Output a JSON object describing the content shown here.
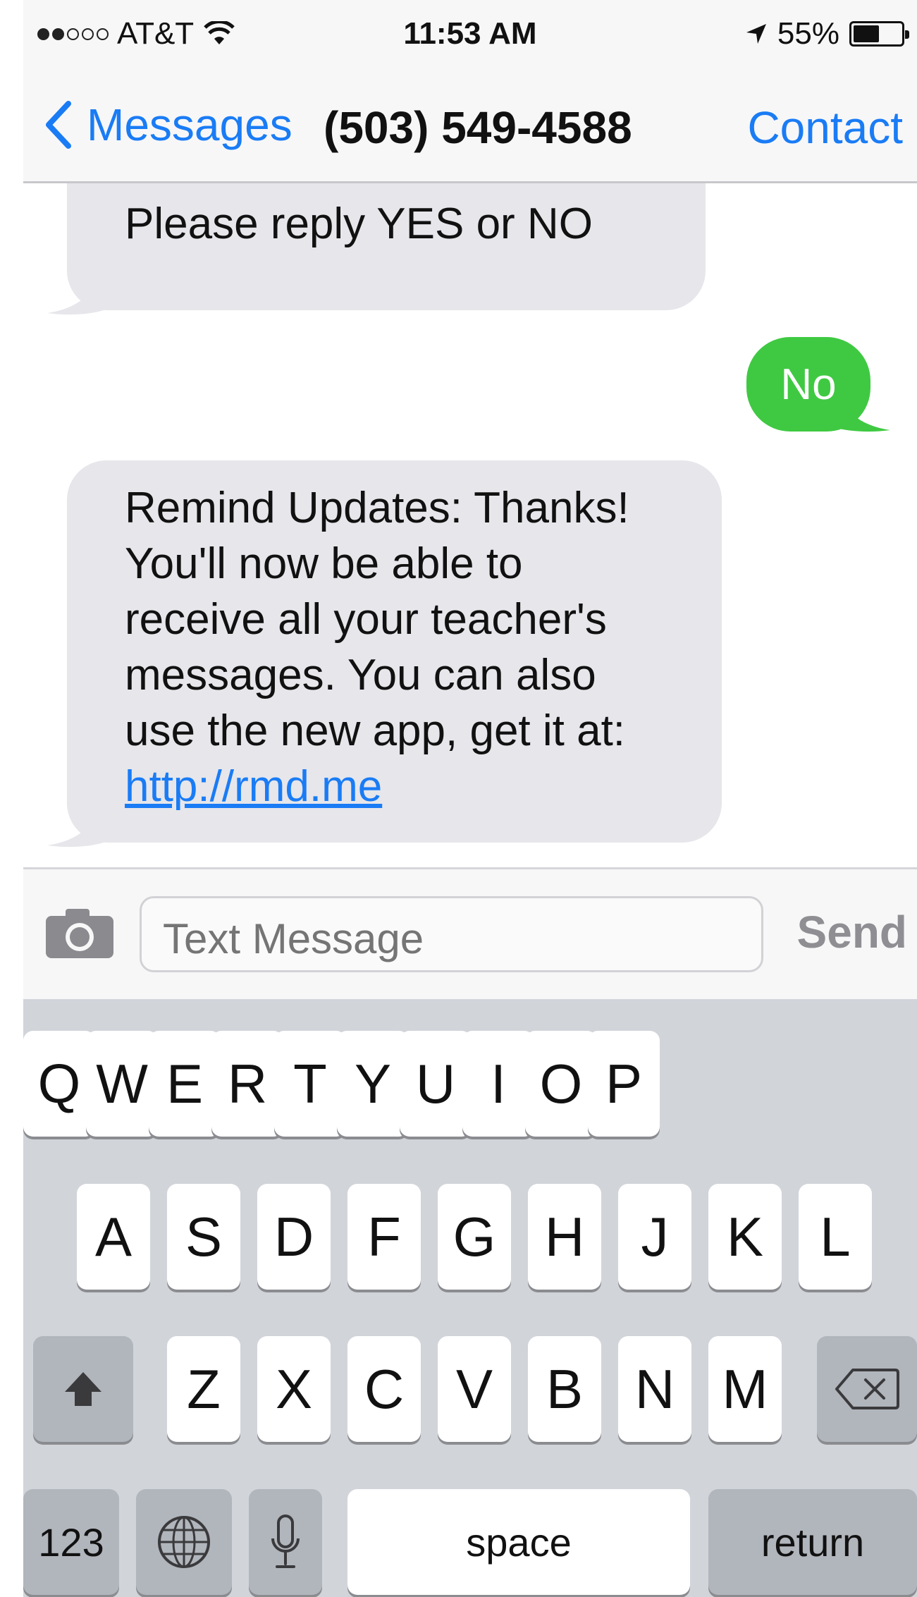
{
  "status_bar": {
    "carrier": "AT&T",
    "time": "11:53 AM",
    "battery": "55%",
    "battery_level": 0.55,
    "signal_bars": 2,
    "icons": [
      "signal-dots-icon",
      "wifi-icon",
      "location-arrow-icon",
      "battery-icon"
    ]
  },
  "nav": {
    "back_label": "Messages",
    "title": "(503) 549-4588",
    "contact_label": "Contact",
    "icons": [
      "chevron-left-icon"
    ]
  },
  "conversation": {
    "messages": [
      {
        "direction": "incoming",
        "lines": [
          "Please reply YES or NO"
        ]
      },
      {
        "direction": "outgoing",
        "lines": [
          "No"
        ]
      },
      {
        "direction": "incoming",
        "lines": [
          "Remind Updates: Thanks!",
          "You'll now be able to",
          "receive all your teacher's",
          "messages. You can also",
          "use the new app, get it at:"
        ],
        "link": "http://rmd.me"
      }
    ]
  },
  "input_bar": {
    "placeholder": "Text Message",
    "send_label": "Send",
    "icons": [
      "camera-icon"
    ]
  },
  "keyboard": {
    "row1": [
      "Q",
      "W",
      "E",
      "R",
      "T",
      "Y",
      "U",
      "I",
      "O",
      "P"
    ],
    "row2": [
      "A",
      "S",
      "D",
      "F",
      "G",
      "H",
      "J",
      "K",
      "L"
    ],
    "row3": [
      "Z",
      "X",
      "C",
      "V",
      "B",
      "N",
      "M"
    ],
    "numbers_label": "123",
    "space_label": "space",
    "return_label": "return",
    "icons": [
      "shift-icon",
      "delete-icon",
      "globe-icon",
      "microphone-icon"
    ]
  },
  "colors": {
    "accent_blue": "#1a7cf5",
    "outgoing_bubble": "#3fc942",
    "incoming_bubble": "#e6e6eb",
    "keyboard_bg": "#d1d4d9"
  }
}
